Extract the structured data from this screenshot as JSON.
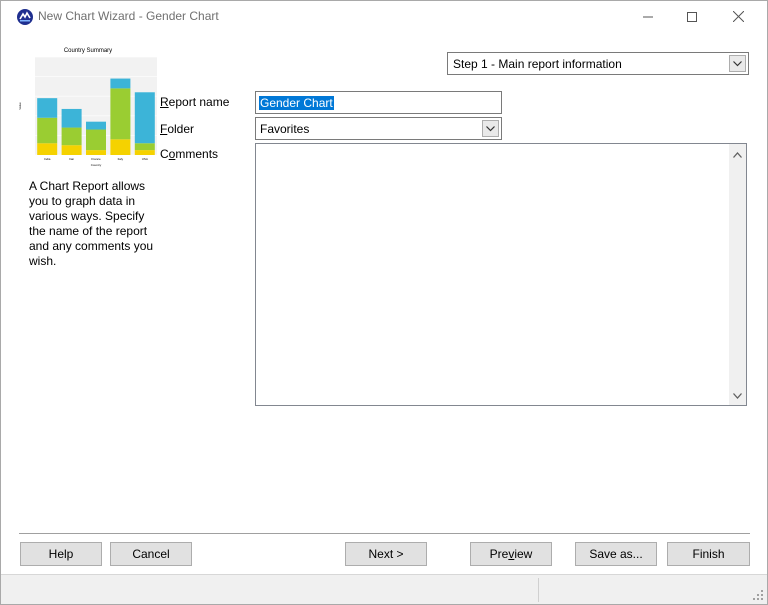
{
  "window": {
    "title": "New Chart Wizard - Gender Chart"
  },
  "titlebar": {
    "minimize_icon": "minimize-icon",
    "maximize_icon": "maximize-icon",
    "close_icon": "close-icon"
  },
  "preview": {
    "chart_data": {
      "type": "bar",
      "title": "Country Summary",
      "xlabel": "Country",
      "ylabel": "Value",
      "categories": [
        "India",
        "Iran",
        "France",
        "Italy",
        "USA"
      ],
      "series": [
        {
          "name": "",
          "values": [
            12,
            10,
            5,
            16,
            5
          ],
          "color": "#f5d200"
        },
        {
          "name": "",
          "values": [
            26,
            18,
            21,
            52,
            7
          ],
          "color": "#9acd32"
        },
        {
          "name": "",
          "values": [
            20,
            19,
            8,
            10,
            52
          ],
          "color": "#3cb4d8"
        }
      ],
      "ylim": [
        0,
        100
      ]
    }
  },
  "description": "A Chart Report allows you to graph data in various ways. Specify the name of the report and any comments you wish.",
  "form": {
    "report_name_label_key": "R",
    "report_name_label_rest": "eport name",
    "report_name_value": "Gender Chart",
    "folder_label_key": "F",
    "folder_label_rest": "older",
    "folder_value": "Favorites",
    "comments_label_pre": "C",
    "comments_label_key": "o",
    "comments_label_rest": "mments",
    "comments_value": ""
  },
  "step_select": {
    "value": "Step 1 - Main report information"
  },
  "buttons": {
    "help": "Help",
    "cancel": "Cancel",
    "next": "Next >",
    "preview_pre": "Pre",
    "preview_key": "v",
    "preview_rest": "iew",
    "save_as": "Save as...",
    "finish": "Finish"
  }
}
